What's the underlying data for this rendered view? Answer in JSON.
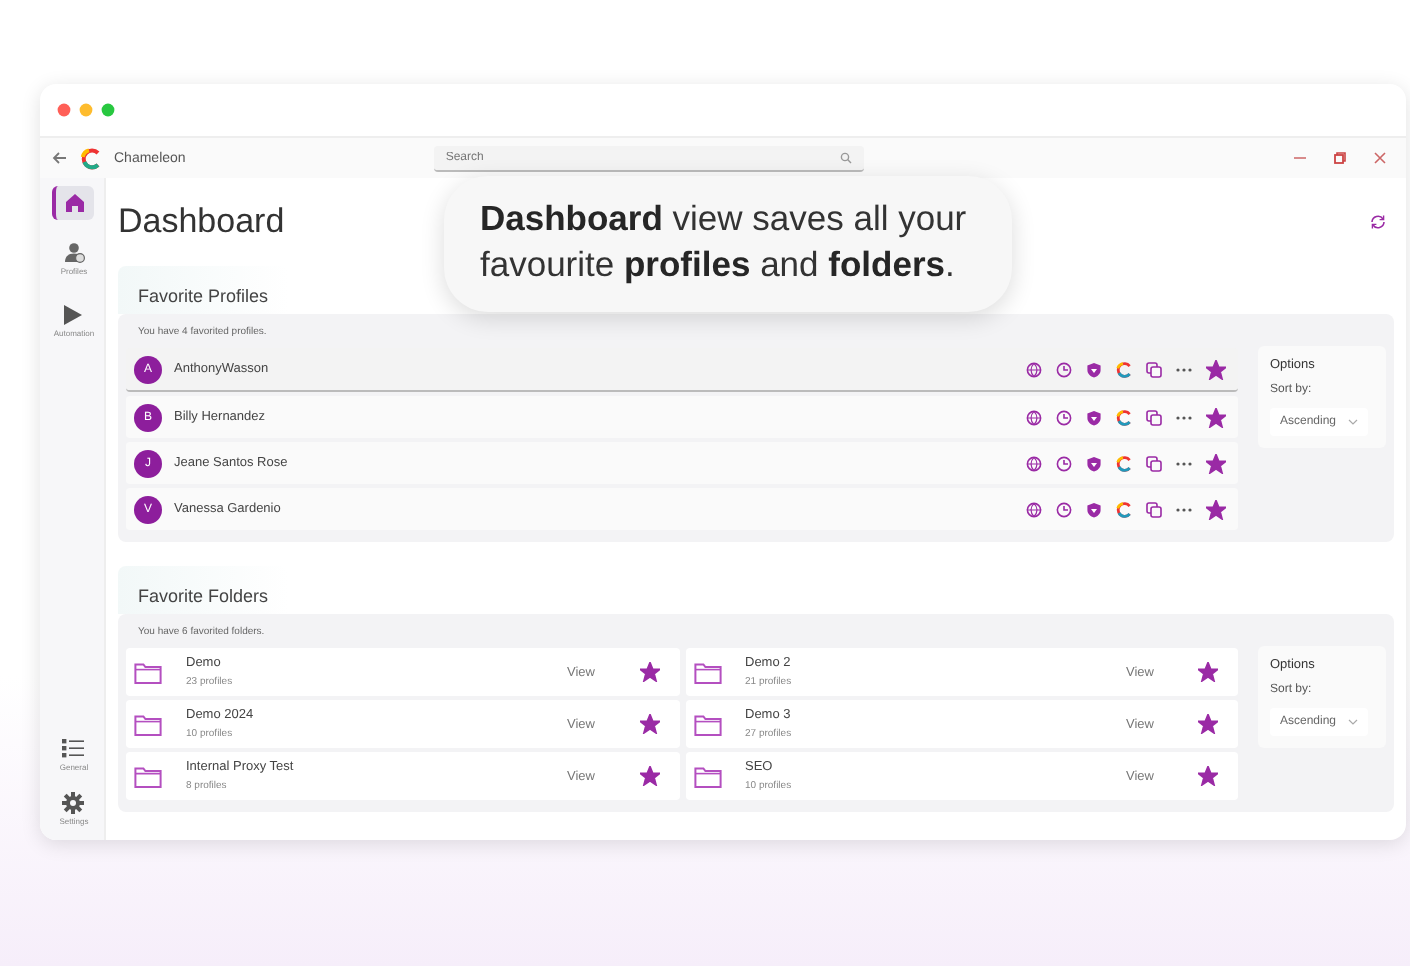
{
  "window": {
    "app_name": "Chameleon",
    "search": {
      "placeholder": "Search"
    }
  },
  "sidebar": {
    "items": [
      {
        "selected": true
      },
      {
        "label": "Profiles",
        "selected": false
      },
      {
        "label": "Automation",
        "selected": false
      }
    ],
    "bottom_items": [
      {
        "label": "General",
        "selected": false
      },
      {
        "label": "Settings",
        "selected": false
      }
    ]
  },
  "page_title": "Dashboard",
  "callout": "**Dashboard** view saves all your favourite **profiles** and **folders**.",
  "profiles": {
    "title": "Favorite Profiles",
    "note": "You have 4 favorited profiles.",
    "items": [
      {
        "initial": "A",
        "name": "AnthonyWasson",
        "favorite": true,
        "selected": true
      },
      {
        "initial": "B",
        "name": "Billy Hernandez",
        "favorite": true,
        "selected": false
      },
      {
        "initial": "J",
        "name": "Jeane Santos Rose",
        "favorite": true,
        "selected": false
      },
      {
        "initial": "V",
        "name": "Vanessa Gardenio",
        "favorite": true,
        "selected": false
      }
    ],
    "options": {
      "title": "Options",
      "sort_label": "Sort by:",
      "sort_value": "Ascending"
    }
  },
  "folders": {
    "title": "Favorite Folders",
    "note": "You have 6 favorited folders.",
    "items": [
      {
        "name": "Demo",
        "count": "23 profiles",
        "action": "View",
        "favorite": true
      },
      {
        "name": "Demo 2",
        "count": "21 profiles",
        "action": "View",
        "favorite": true
      },
      {
        "name": "Demo 2024",
        "count": "10 profiles",
        "action": "View",
        "favorite": true
      },
      {
        "name": "Demo 3",
        "count": "27 profiles",
        "action": "View",
        "favorite": true
      },
      {
        "name": "Internal Proxy Test",
        "count": "8 profiles",
        "action": "View",
        "favorite": true
      },
      {
        "name": "SEO",
        "count": "10 profiles",
        "action": "View",
        "favorite": true
      }
    ],
    "options": {
      "title": "Options",
      "sort_label": "Sort by:",
      "sort_value": "Ascending"
    }
  }
}
